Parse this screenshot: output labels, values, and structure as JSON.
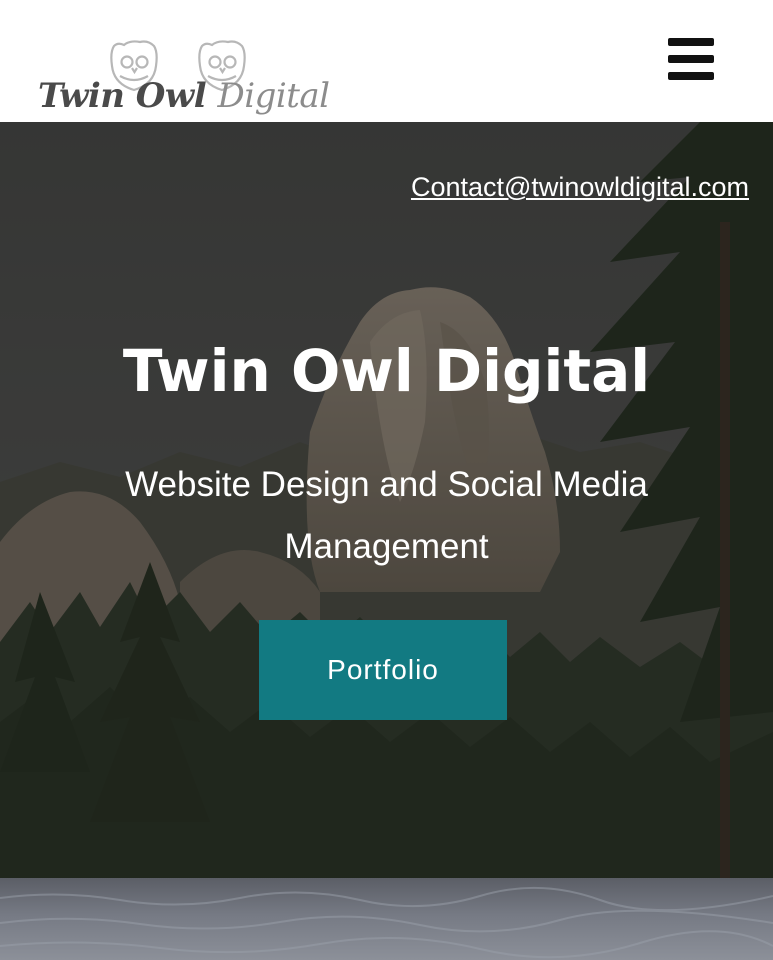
{
  "header": {
    "logo": {
      "text_main": "Twin Owl",
      "text_accent": "Digital"
    },
    "menu_icon": "hamburger-menu-icon"
  },
  "hero": {
    "contact_email": "Contact@twinowldigital.com",
    "title": "Twin Owl Digital",
    "subtitle": "Website Design and Social Media Management",
    "button_label": "Portfolio",
    "background": "mountain-rock-forest-photo"
  },
  "colors": {
    "accent": "#127a82",
    "header_bg": "#ffffff",
    "text_light": "#ffffff",
    "logo_text": "#4a4a4a"
  }
}
